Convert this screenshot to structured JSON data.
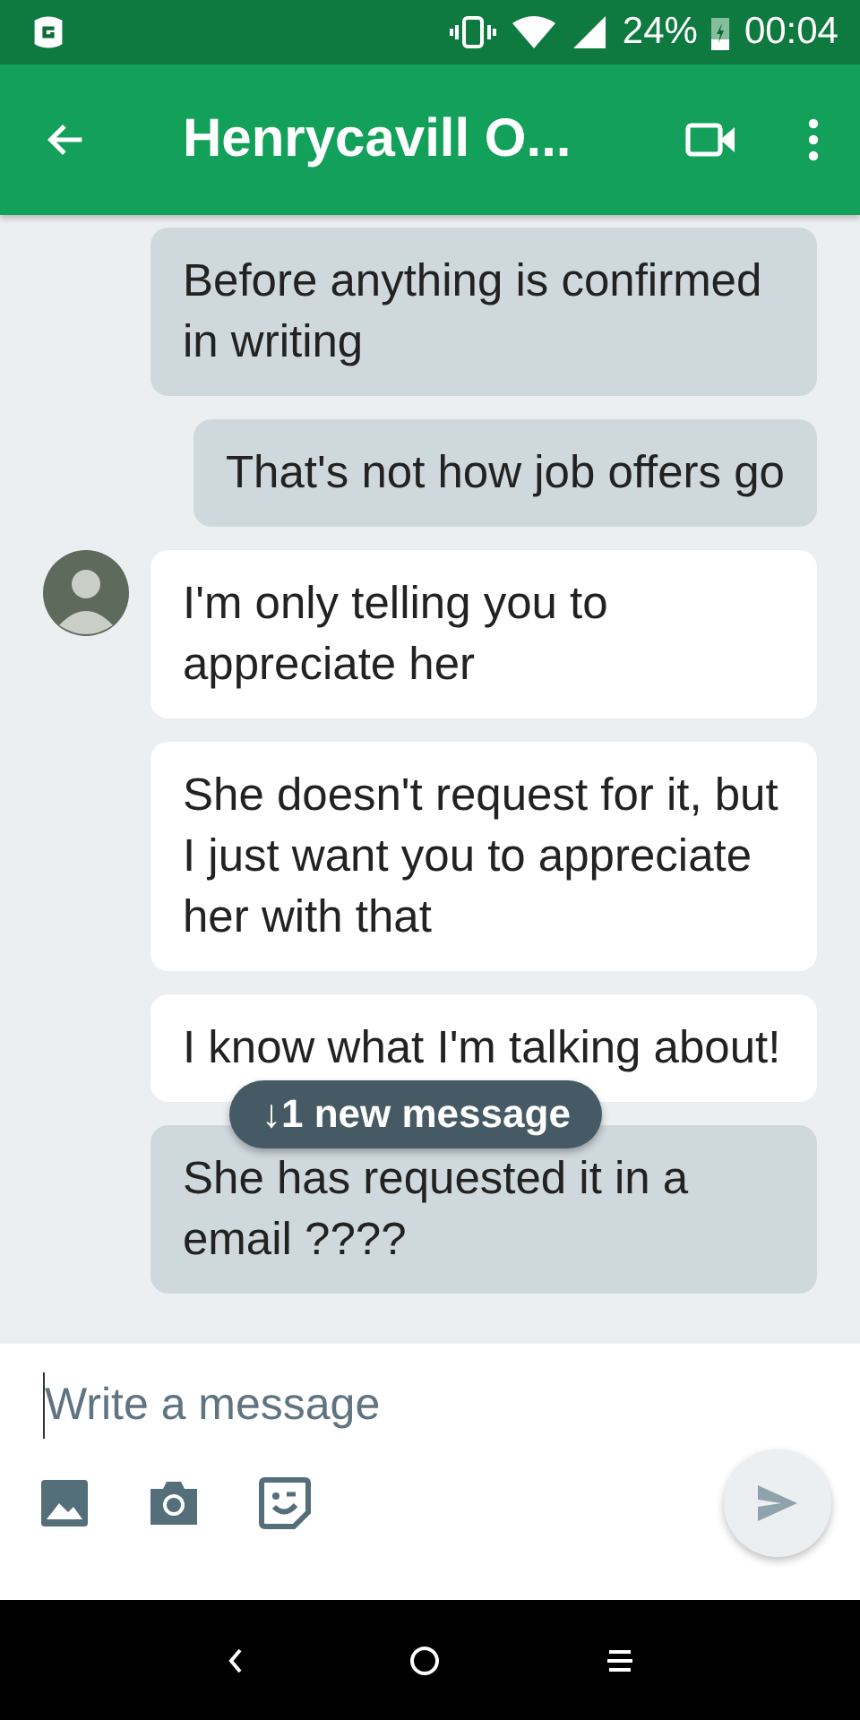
{
  "status_bar": {
    "battery": "24%",
    "time": "00:04"
  },
  "header": {
    "title": "Henrycavill O..."
  },
  "messages": [
    {
      "kind": "outgoing",
      "text": "Before anything is confirmed in writing",
      "avatar": false
    },
    {
      "kind": "outgoing",
      "text": "That's not how job offers go",
      "avatar": false
    },
    {
      "kind": "incoming",
      "text": "I'm only telling you to appreciate her",
      "avatar": true
    },
    {
      "kind": "incoming",
      "text": "She doesn't request for it, but I just want you to appreciate her with that",
      "avatar": false
    },
    {
      "kind": "incoming",
      "text": "I know what I'm talking about!",
      "avatar": false
    },
    {
      "kind": "outgoing",
      "text": "She has requested it in a email ????",
      "avatar": false
    }
  ],
  "new_message_pill": "↓1 new message",
  "composer": {
    "placeholder": "Write a message"
  }
}
